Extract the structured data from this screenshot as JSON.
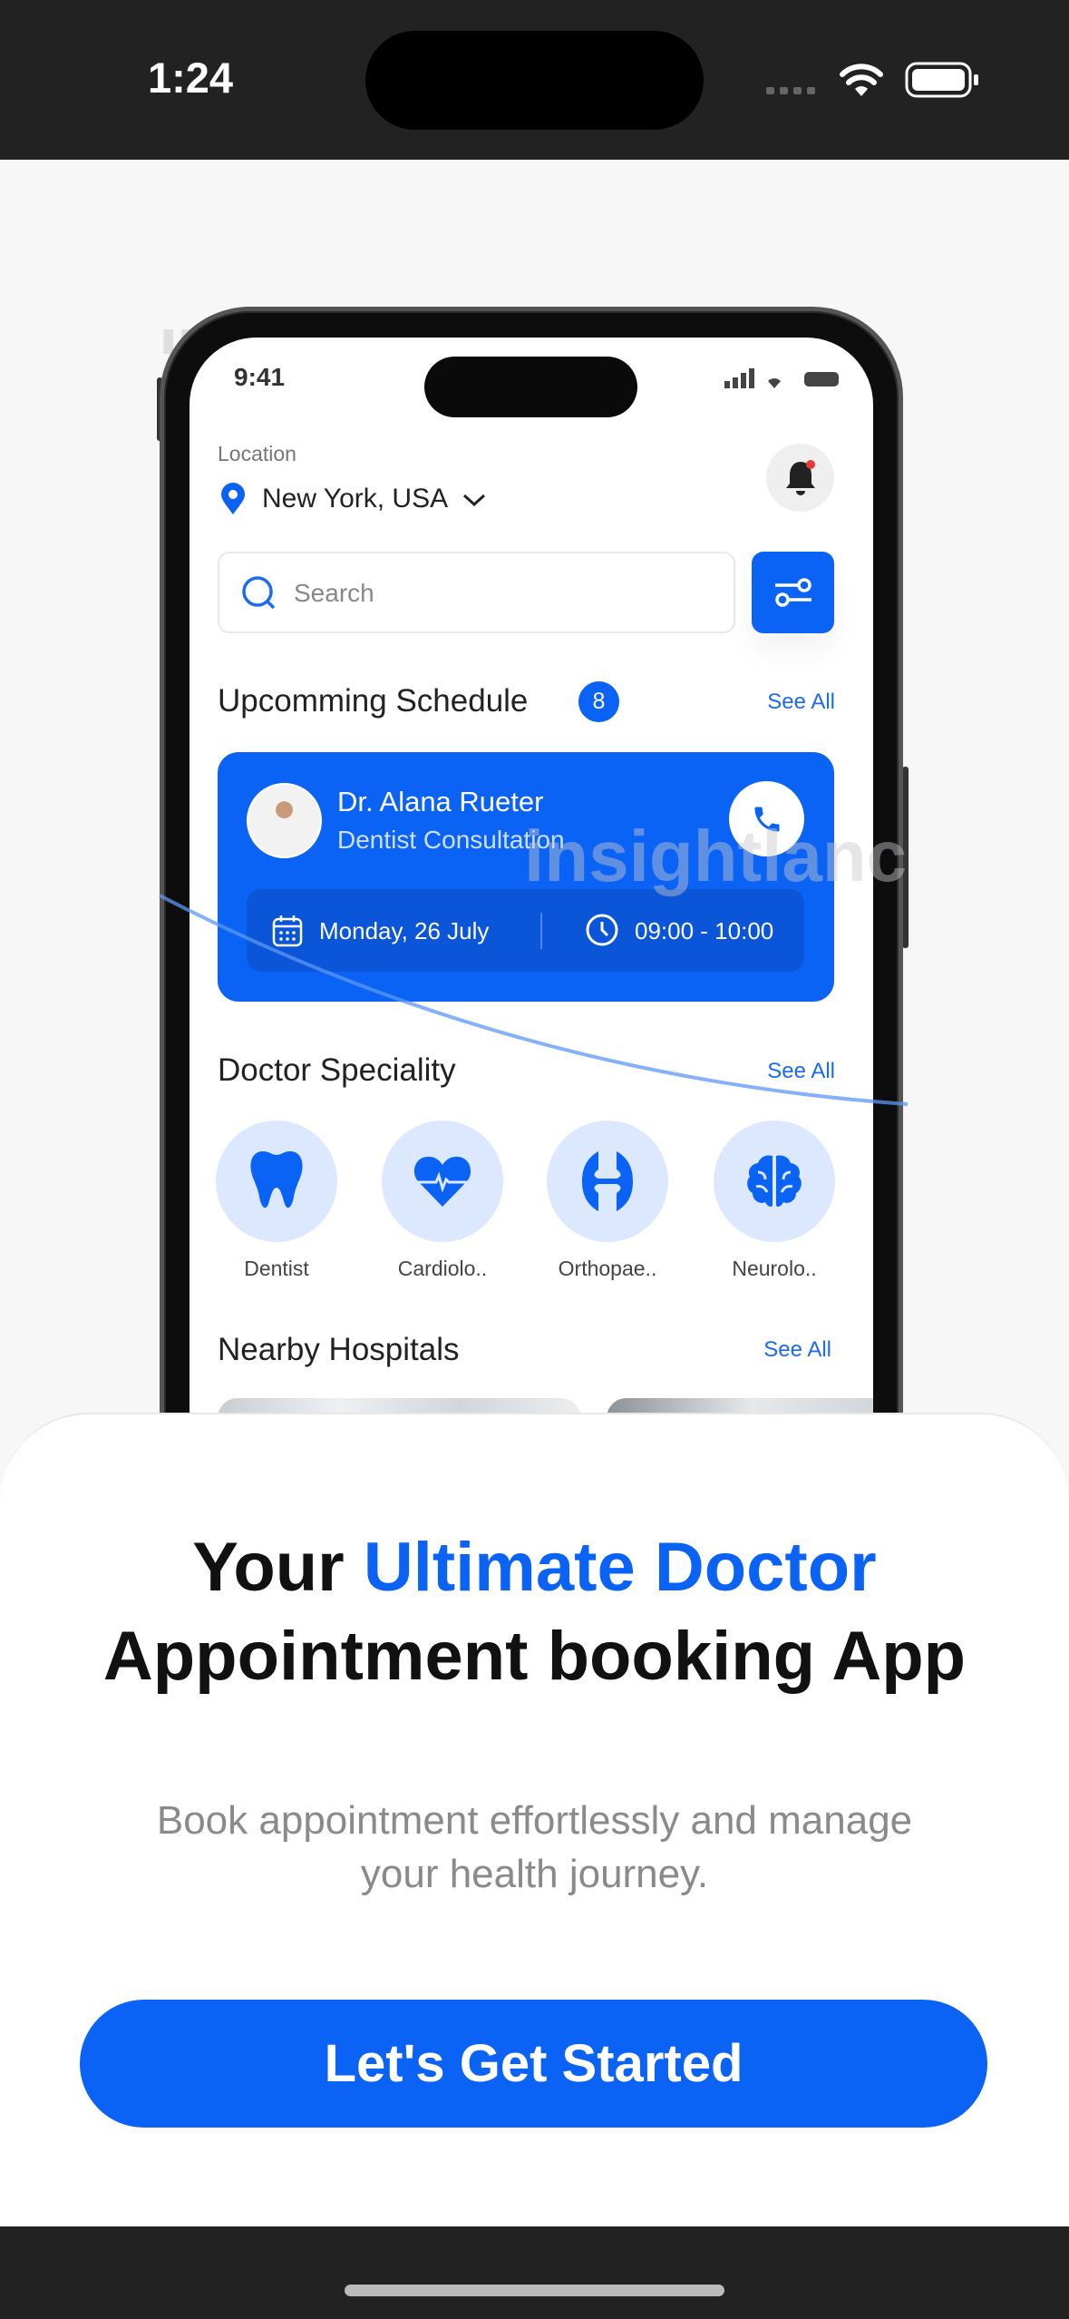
{
  "status_bar": {
    "time": "1:24"
  },
  "mockup": {
    "status_time": "9:41",
    "location_label": "Location",
    "location_value": "New York, USA",
    "search_placeholder": "Search",
    "schedule": {
      "title": "Upcomming Schedule",
      "count": "8",
      "see_all": "See All"
    },
    "appointment": {
      "doctor": "Dr. Alana Rueter",
      "type": "Dentist Consultation",
      "date": "Monday, 26 July",
      "time": "09:00 - 10:00"
    },
    "speciality": {
      "title": "Doctor Speciality",
      "see_all": "See All",
      "items": [
        {
          "label": "Dentist",
          "icon": "tooth-icon"
        },
        {
          "label": "Cardiolo..",
          "icon": "heart-pulse-icon"
        },
        {
          "label": "Orthopae..",
          "icon": "joint-icon"
        },
        {
          "label": "Neurolo..",
          "icon": "brain-icon"
        }
      ]
    },
    "hospitals": {
      "title": "Nearby Hospitals",
      "see_all": "See All"
    },
    "watermark": "insightlancer"
  },
  "onboarding": {
    "heading_prefix": "Your ",
    "heading_highlight": "Ultimate Doctor",
    "heading_line2": "Appointment booking App",
    "subtitle_line1": "Book appointment effortlessly and manage",
    "subtitle_line2": "your health journey.",
    "cta": "Let's Get Started"
  },
  "colors": {
    "accent": "#0a63f5",
    "card_inner": "#0a55d8",
    "speciality_bg": "#dce8fd",
    "status_bar": "#222222"
  }
}
